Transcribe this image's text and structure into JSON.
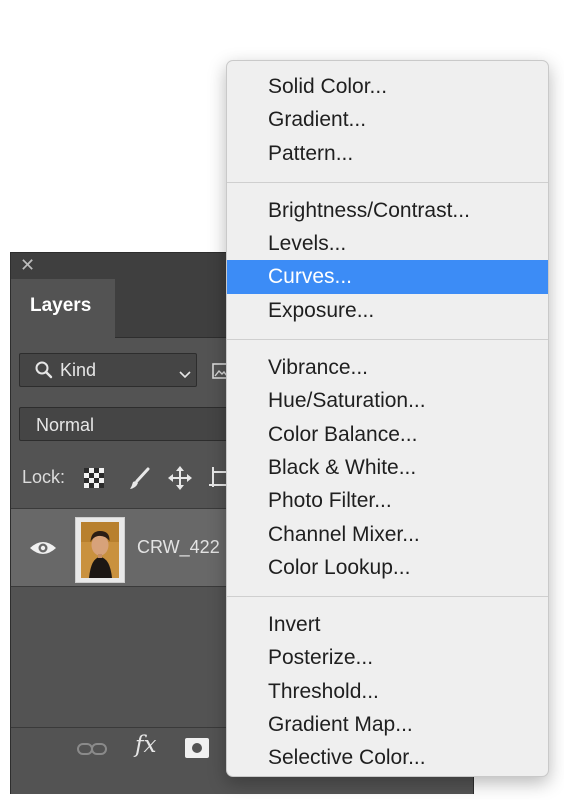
{
  "panel": {
    "tab_label": "Layers",
    "close_glyph": "✕",
    "kind_filter": {
      "label": "Kind",
      "icon": "search-icon"
    },
    "blend_mode": "Normal",
    "lock_label": "Lock:",
    "lock_icons": [
      "lock-transparent-pixels-icon",
      "lock-image-pixels-icon",
      "lock-position-icon",
      "lock-artboard-icon"
    ],
    "layer": {
      "name": "CRW_422",
      "visibility_icon": "eye-icon"
    },
    "bottom_icons": [
      "link-layers-icon",
      "fx-icon",
      "add-mask-icon"
    ],
    "bottom_fx_label": "fx"
  },
  "menu": {
    "groups": [
      [
        {
          "label": "Solid Color..."
        },
        {
          "label": "Gradient..."
        },
        {
          "label": "Pattern..."
        }
      ],
      [
        {
          "label": "Brightness/Contrast..."
        },
        {
          "label": "Levels..."
        },
        {
          "label": "Curves...",
          "highlighted": true
        },
        {
          "label": "Exposure..."
        }
      ],
      [
        {
          "label": "Vibrance..."
        },
        {
          "label": "Hue/Saturation..."
        },
        {
          "label": "Color Balance..."
        },
        {
          "label": "Black & White..."
        },
        {
          "label": "Photo Filter..."
        },
        {
          "label": "Channel Mixer..."
        },
        {
          "label": "Color Lookup..."
        }
      ],
      [
        {
          "label": "Invert"
        },
        {
          "label": "Posterize..."
        },
        {
          "label": "Threshold..."
        },
        {
          "label": "Gradient Map..."
        },
        {
          "label": "Selective Color..."
        }
      ]
    ]
  },
  "colors": {
    "panel_bg": "#535353",
    "selected_layer_bg": "#686868",
    "menu_bg": "#efefef",
    "menu_highlight": "#3c8cf6"
  }
}
